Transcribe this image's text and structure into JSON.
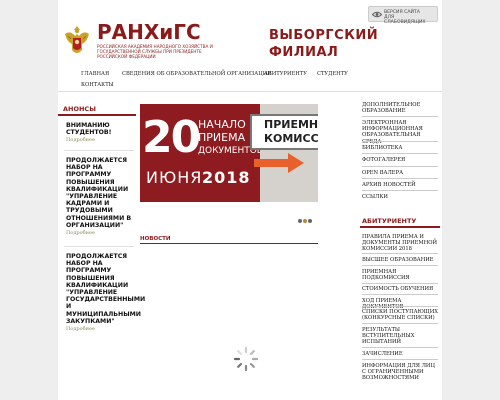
{
  "header": {
    "logo_title": "РАНХиГС",
    "logo_subtitle": "РОССИЙСКАЯ АКАДЕМИЯ НАРОДНОГО ХОЗЯЙСТВА И ГОСУДАРСТВЕННОЙ СЛУЖБЫ ПРИ ПРЕЗИДЕНТЕ РОССИЙСКОЙ ФЕДЕРАЦИИ",
    "branch_line1": "ВЫБОРГСКИЙ",
    "branch_line2": "ФИЛИАЛ",
    "vision_line1": "ВЕРСИЯ САЙТА",
    "vision_line2": "ДЛЯ СЛАБОВИДЯЩИХ"
  },
  "nav": {
    "items": [
      "Главная",
      "Сведения об образовательной организации",
      "Абитуриенту",
      "Студенту",
      "Контакты"
    ]
  },
  "announcements": {
    "title": "АНОНСЫ",
    "items": [
      {
        "title": "ВНИМАНИЮ СТУДЕНТОВ!",
        "more": "Подробнее"
      },
      {
        "title": "ПРОДОЛЖАЕТСЯ НАБОР НА ПРОГРАММУ ПОВЫШЕНИЯ КВАЛИФИКАЦИИ \"УПРАВЛЕНИЕ КАДРАМИ И ТРУДОВЫМИ ОТНОШЕНИЯМИ В ОРГАНИЗАЦИИ\"",
        "more": "Подробнее"
      },
      {
        "title": "ПРОДОЛЖАЕТСЯ НАБОР НА ПРОГРАММУ ПОВЫШЕНИЯ КВАЛИФИКАЦИИ \"УПРАВЛЕНИЕ ГОСУДАРСТВЕННЫМИ И МУНИЦИПАЛЬНЫМИ ЗАКУПКАМИ\"",
        "more": "Подробнее"
      }
    ]
  },
  "banner": {
    "day": "20",
    "line1": "НАЧАЛО",
    "line2": "ПРИЕМА",
    "line3": "ДОКУМЕНТОВ",
    "month": "ИЮНЯ",
    "year": "2018",
    "sign_line1": "ПРИЕМНАЯ",
    "sign_line2": "КОМИССИЯ",
    "slide_count": 3,
    "active_slide": 1
  },
  "news": {
    "title": "НОВОСТИ"
  },
  "right_menu": {
    "items": [
      "ДОПОЛНИТЕЛЬНОЕ ОБРАЗОВАНИЕ",
      "ЭЛЕКТРОННАЯ ИНФОРМАЦИОННАЯ ОБРАЗОВАТЕЛЬНАЯ СРЕДА",
      "БИБЛИОТЕКА",
      "ФОТОГАЛЕРЕЯ",
      "OPEN ВАЛЕРА",
      "АРХИВ НОВОСТЕЙ",
      "ССЫЛКИ"
    ]
  },
  "applicant": {
    "title": "АБИТУРИЕНТУ",
    "items": [
      "ПРАВИЛА ПРИЕМА И ДОКУМЕНТЫ ПРИЕМНОЙ КОМИССИИ 2018",
      "ВЫСШЕЕ ОБРАЗОВАНИЕ",
      "ПРИЕМНАЯ ПОДКОМИССИЯ",
      "СТОИМОСТЬ ОБУЧЕНИЯ",
      "ХОД ПРИЕМА ДОКУМЕНТОВ",
      "СПИСКИ ПОСТУПАЮЩИХ (КОНКУРСНЫЕ СПИСКИ)",
      "РЕЗУЛЬТАТЫ ВСТУПИТЕЛЬНЫХ ИСПЫТАНИЙ",
      "ЗАЧИСЛЕНИЕ",
      "ИНФОРМАЦИЯ ДЛЯ ЛИЦ С ОГРАНИЧЕННЫМИ ВОЗМОЖНОСТЯМИ"
    ]
  },
  "colors": {
    "brand": "#8b1a1a",
    "banner_red": "#8e1b1f",
    "page_bg": "#eeeeee"
  }
}
